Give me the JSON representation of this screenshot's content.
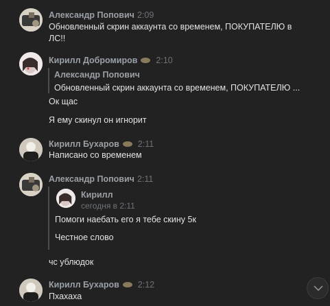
{
  "messages": [
    {
      "author": "Александр Попович",
      "time": "2:09",
      "lines": [
        "Обновленный скрин аккаунта со временем, ПОКУПАТЕЛЮ в",
        "ЛС!!"
      ]
    },
    {
      "author": "Кирилл Добромиров",
      "time": "2:10",
      "quote": {
        "author": "Александр Попович",
        "text": "Обновленный скрин аккаунта со временем, ПОКУПАТЕЛЮ ..."
      },
      "lines": [
        "Ок щас",
        "Я ему скинул он игнорит"
      ]
    },
    {
      "author": "Кирилл Бухаров",
      "time": "2:11",
      "lines": [
        "Написано со временем"
      ]
    },
    {
      "author": "Александр Попович",
      "time": "2:11",
      "forward": {
        "author": "Кирилл",
        "time": "сегодня в 2:11",
        "lines": [
          "Помоги наебать его я тебе скину 5к",
          "Честное слово"
        ]
      },
      "lines": [
        "чс ублюдок"
      ]
    },
    {
      "author": "Кирилл Бухаров",
      "time": "2:12",
      "lines": [
        "Пхахаха"
      ]
    }
  ],
  "icons": {
    "scroll_down": "chevron-down-icon",
    "author_status": "emoji-icon"
  },
  "colors": {
    "background": "#222222",
    "author": "#9aa0a6",
    "text": "#e1e3e6",
    "time": "#6f7378"
  }
}
